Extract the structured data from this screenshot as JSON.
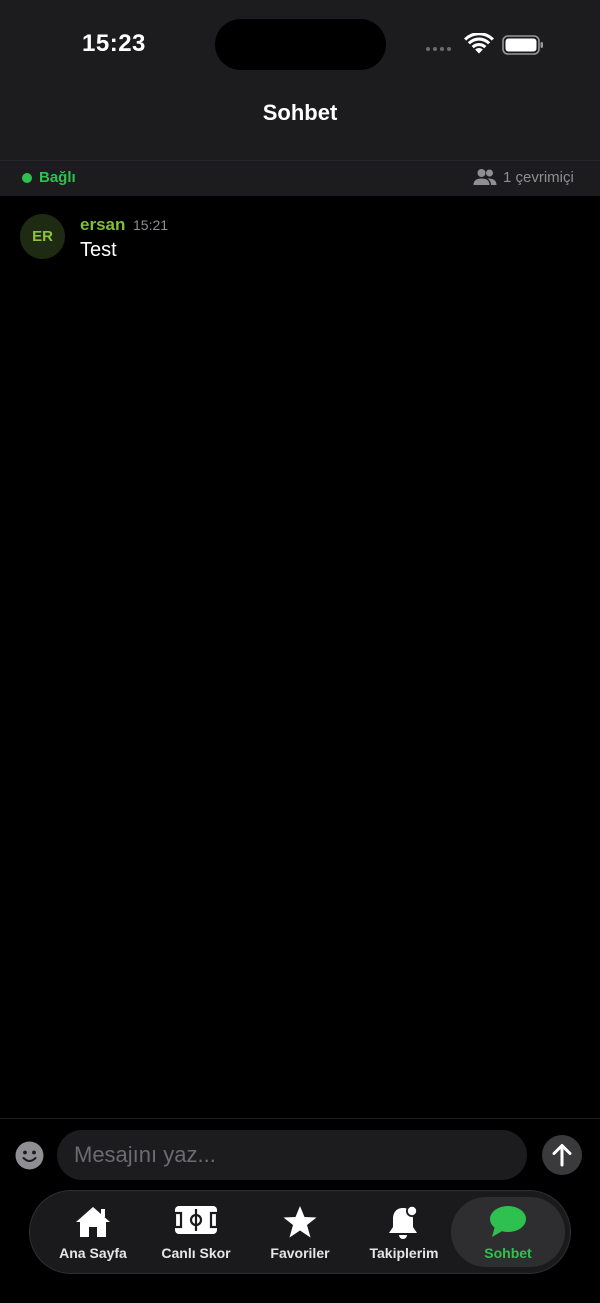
{
  "status_bar": {
    "time": "15:23"
  },
  "header": {
    "title": "Sohbet"
  },
  "connection": {
    "status": "Bağlı",
    "online": "1 çevrimiçi",
    "status_color": "#2fc14f"
  },
  "messages": [
    {
      "initials": "ER",
      "user": "ersan",
      "time": "15:21",
      "text": "Test"
    }
  ],
  "composer": {
    "placeholder": "Mesajını yaz..."
  },
  "tabs": [
    {
      "label": "Ana Sayfa",
      "icon": "home-icon"
    },
    {
      "label": "Canlı Skor",
      "icon": "pitch-icon"
    },
    {
      "label": "Favoriler",
      "icon": "star-icon"
    },
    {
      "label": "Takiplerim",
      "icon": "bell-icon"
    },
    {
      "label": "Sohbet",
      "icon": "chat-bubble-icon",
      "active": true
    }
  ],
  "colors": {
    "accent": "#2fc14f",
    "username": "#7fbf3a",
    "background": "#000000",
    "surface": "#1c1c1e"
  }
}
